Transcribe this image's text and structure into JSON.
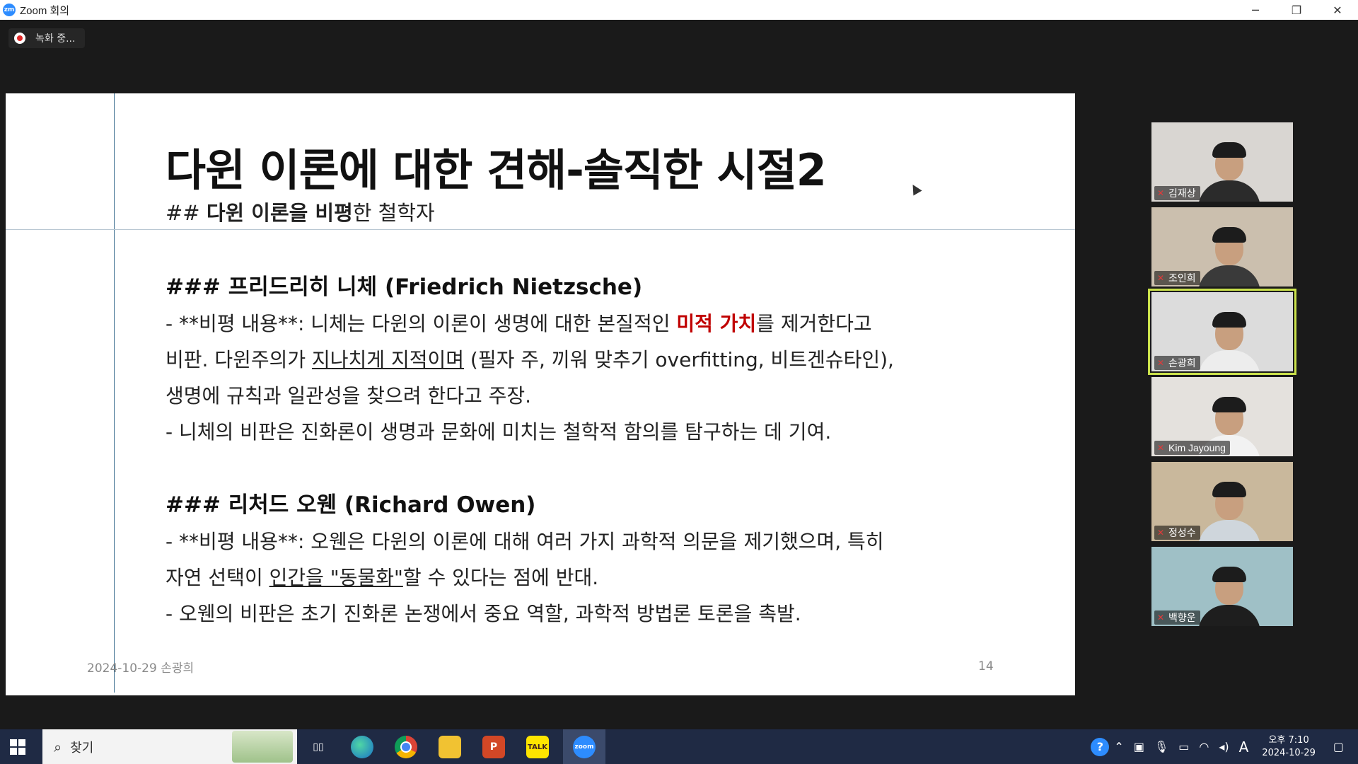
{
  "window": {
    "app_icon": "zoom-logo",
    "app_icon_text": "zm",
    "title": "Zoom 회의",
    "minimize": "─",
    "restore": "❐",
    "close": "✕"
  },
  "recording": {
    "label": "녹화 중..."
  },
  "slide": {
    "title": "다윈 이론에 대한 견해-솔직한 시절2",
    "subtitle_prefix": "## ",
    "subtitle_bold": "다윈 이론을 비평",
    "subtitle_rest": "한 철학자",
    "section1": {
      "heading": "### 프리드리히 니체 (Friedrich Nietzsche)",
      "line1_a": "- **비평 내용**: 니체는 다윈의 이론이 생명에 대한 본질적인 ",
      "line1_red": "미적 가치",
      "line1_b": "를 제거한다고",
      "line2_a": "비판. 다윈주의가 ",
      "line2_u": "지나치게 지적이며",
      "line2_b": " (필자 주, 끼워 맞추기 overfitting, 비트겐슈타인),",
      "line3": "생명에 규칙과 일관성을 찾으려 한다고 주장.",
      "line4": "- 니체의 비판은 진화론이 생명과 문화에 미치는 철학적 함의를 탐구하는 데 기여."
    },
    "section2": {
      "heading": "### 리처드 오웬 (Richard Owen)",
      "line1": "- **비평 내용**: 오웬은 다윈의 이론에 대해 여러 가지 과학적 의문을 제기했으며, 특히",
      "line2_a": "자연 선택이 ",
      "line2_u": "인간을 \"동물화\"",
      "line2_b": "할 수 있다는 점에 반대.",
      "line3": "- 오웬의 비판은 초기 진화론 논쟁에서 중요 역할, 과학적 방법론 토론을 촉발."
    },
    "footer_left": "2024-10-29 손광희",
    "page_number": "14"
  },
  "participants": [
    {
      "name": "김재상",
      "bg": "#d9d6d2",
      "shirt": "#2b2b2b",
      "muted": true
    },
    {
      "name": "조인희",
      "bg": "#cbbfae",
      "shirt": "#3a3a3a",
      "muted": true
    },
    {
      "name": "손광희",
      "bg": "#dcdcdc",
      "shirt": "#ededed",
      "muted": true,
      "active": true
    },
    {
      "name": "Kim Jayoung",
      "bg": "#e4e1dd",
      "shirt": "#f2f2f2",
      "muted": true
    },
    {
      "name": "정성수",
      "bg": "#c9b89c",
      "shirt": "#cfd6dc",
      "muted": true
    },
    {
      "name": "백향운",
      "bg": "#9fc0c6",
      "shirt": "#1e1e1e",
      "muted": true
    }
  ],
  "taskbar": {
    "search_label": "찾기",
    "apps": [
      "task-view",
      "edge",
      "chrome",
      "file-explorer",
      "powerpoint",
      "kakaotalk",
      "zoom"
    ],
    "kakaotalk_label": "TALK",
    "zoom_label": "zoom",
    "powerpoint_label": "P",
    "ime": "A",
    "time": "오후 7:10",
    "date": "2024-10-29"
  }
}
